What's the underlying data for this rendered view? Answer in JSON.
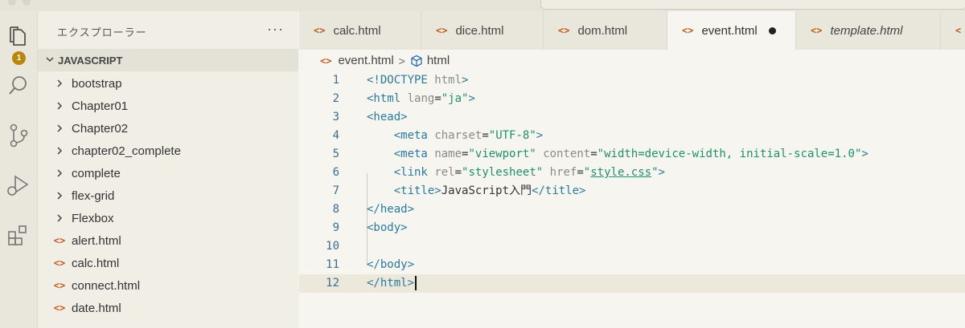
{
  "explorer": {
    "title": "エクスプローラー",
    "more": "···",
    "badge": "1",
    "section": "JAVASCRIPT",
    "items": [
      {
        "label": "bootstrap",
        "type": "folder"
      },
      {
        "label": "Chapter01",
        "type": "folder"
      },
      {
        "label": "Chapter02",
        "type": "folder"
      },
      {
        "label": "chapter02_complete",
        "type": "folder"
      },
      {
        "label": "complete",
        "type": "folder"
      },
      {
        "label": "flex-grid",
        "type": "folder"
      },
      {
        "label": "Flexbox",
        "type": "folder"
      },
      {
        "label": "alert.html",
        "type": "file"
      },
      {
        "label": "calc.html",
        "type": "file"
      },
      {
        "label": "connect.html",
        "type": "file"
      },
      {
        "label": "date.html",
        "type": "file"
      }
    ]
  },
  "tabs": [
    {
      "label": "calc.html"
    },
    {
      "label": "dice.html"
    },
    {
      "label": "dom.html"
    },
    {
      "label": "event.html",
      "active": true,
      "dirty": true
    },
    {
      "label": "template.html",
      "preview": true
    }
  ],
  "breadcrumb": {
    "file": "event.html",
    "node": "html",
    "sep": ">"
  },
  "editor": {
    "lines": [
      {
        "n": "1",
        "tokens": [
          [
            "tag",
            "<!DOCTYPE"
          ],
          [
            "txt",
            " "
          ],
          [
            "attr",
            "html"
          ],
          [
            "tag",
            ">"
          ]
        ]
      },
      {
        "n": "2",
        "tokens": [
          [
            "tag",
            "<html"
          ],
          [
            "txt",
            " "
          ],
          [
            "attr",
            "lang"
          ],
          [
            "txt",
            "="
          ],
          [
            "str",
            "\"ja\""
          ],
          [
            "tag",
            ">"
          ]
        ]
      },
      {
        "n": "3",
        "tokens": [
          [
            "tag",
            "<head>"
          ]
        ]
      },
      {
        "n": "4",
        "tokens": [
          [
            "txt",
            "    "
          ],
          [
            "tag",
            "<meta"
          ],
          [
            "txt",
            " "
          ],
          [
            "attr",
            "charset"
          ],
          [
            "txt",
            "="
          ],
          [
            "str",
            "\"UTF-8\""
          ],
          [
            "tag",
            ">"
          ]
        ]
      },
      {
        "n": "5",
        "tokens": [
          [
            "txt",
            "    "
          ],
          [
            "tag",
            "<meta"
          ],
          [
            "txt",
            " "
          ],
          [
            "attr",
            "name"
          ],
          [
            "txt",
            "="
          ],
          [
            "str",
            "\"viewport\""
          ],
          [
            "txt",
            " "
          ],
          [
            "attr",
            "content"
          ],
          [
            "txt",
            "="
          ],
          [
            "str",
            "\"width=device-width, initial-scale=1.0\""
          ],
          [
            "tag",
            ">"
          ]
        ]
      },
      {
        "n": "6",
        "tokens": [
          [
            "txt",
            "    "
          ],
          [
            "tag",
            "<link"
          ],
          [
            "txt",
            " "
          ],
          [
            "attr",
            "rel"
          ],
          [
            "txt",
            "="
          ],
          [
            "str",
            "\"stylesheet\""
          ],
          [
            "txt",
            " "
          ],
          [
            "attr",
            "href"
          ],
          [
            "txt",
            "="
          ],
          [
            "str",
            "\""
          ],
          [
            "str link",
            "style.css"
          ],
          [
            "str",
            "\""
          ],
          [
            "tag",
            ">"
          ]
        ]
      },
      {
        "n": "7",
        "tokens": [
          [
            "txt",
            "    "
          ],
          [
            "tag",
            "<title>"
          ],
          [
            "txt",
            "JavaScript入門"
          ],
          [
            "tag",
            "</title>"
          ]
        ]
      },
      {
        "n": "8",
        "tokens": [
          [
            "tag",
            "</head>"
          ]
        ]
      },
      {
        "n": "9",
        "tokens": [
          [
            "tag",
            "<body>"
          ]
        ]
      },
      {
        "n": "10",
        "tokens": []
      },
      {
        "n": "11",
        "tokens": [
          [
            "tag",
            "</body>"
          ]
        ]
      },
      {
        "n": "12",
        "tokens": [
          [
            "tag",
            "</html>"
          ]
        ],
        "current": true
      }
    ]
  },
  "colors": {
    "accent": "#b8860b",
    "html_icon": "#c05a1b",
    "tag": "#2a7a9e",
    "string": "#1f8f6f"
  }
}
